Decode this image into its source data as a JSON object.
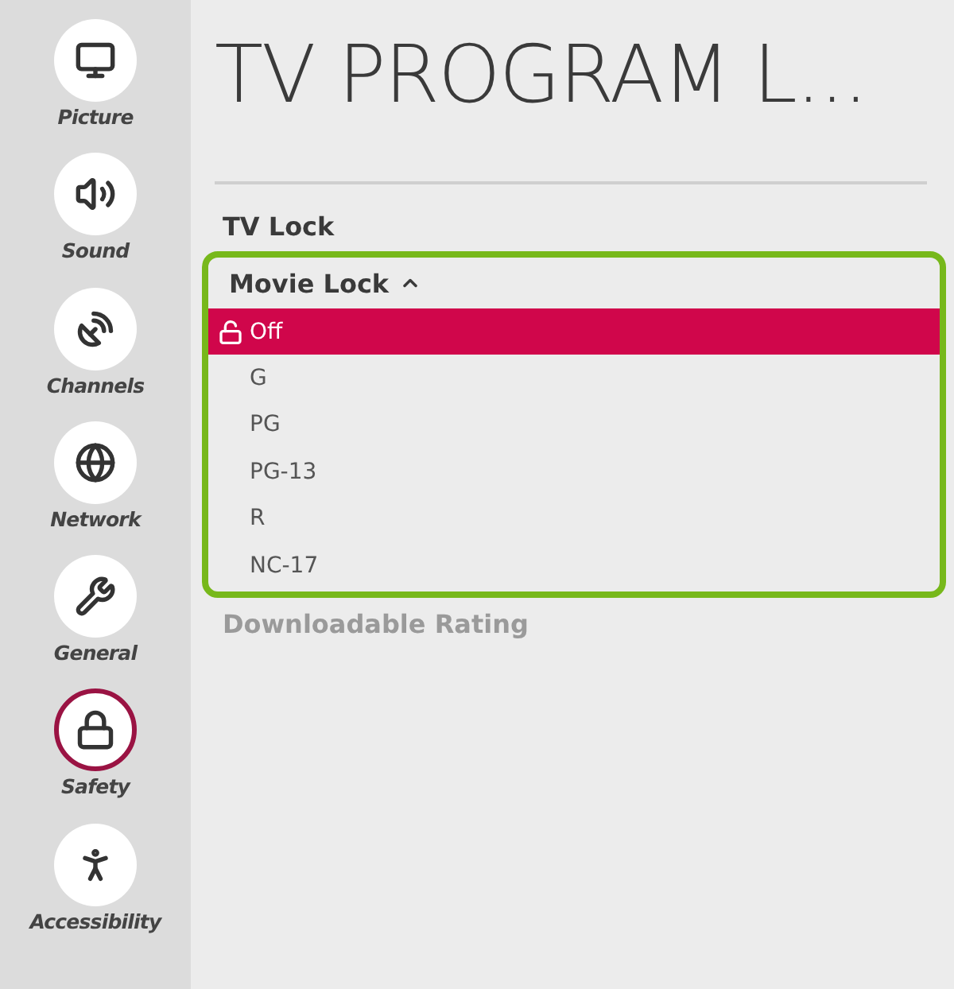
{
  "sidebar": {
    "items": [
      {
        "label": "Picture",
        "selected": false
      },
      {
        "label": "Sound",
        "selected": false
      },
      {
        "label": "Channels",
        "selected": false
      },
      {
        "label": "Network",
        "selected": false
      },
      {
        "label": "General",
        "selected": false
      },
      {
        "label": "Safety",
        "selected": true
      },
      {
        "label": "Accessibility",
        "selected": false
      }
    ]
  },
  "title": "TV PROGRAM L...",
  "menu": [
    {
      "label": "TV Lock",
      "disabled": false
    },
    {
      "label": "Movie Lock",
      "disabled": false,
      "expanded": true,
      "options": [
        {
          "label": "Off",
          "selected": true
        },
        {
          "label": "G",
          "selected": false
        },
        {
          "label": "PG",
          "selected": false
        },
        {
          "label": "PG-13",
          "selected": false
        },
        {
          "label": "R",
          "selected": false
        },
        {
          "label": "NC-17",
          "selected": false
        }
      ]
    },
    {
      "label": "Downloadable Rating",
      "disabled": true
    }
  ]
}
